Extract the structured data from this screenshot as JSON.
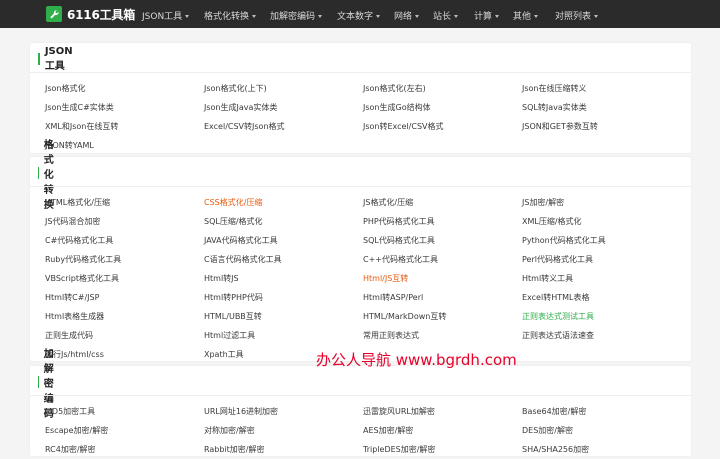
{
  "header": {
    "logo_text": "6116工具箱",
    "nav": [
      {
        "label": "JSON工具"
      },
      {
        "label": "格式化转换"
      },
      {
        "label": "加解密编码"
      },
      {
        "label": "文本数字"
      },
      {
        "label": "网络"
      },
      {
        "label": "站长"
      },
      {
        "label": "计算"
      },
      {
        "label": "其他"
      },
      {
        "label": "对照列表"
      }
    ]
  },
  "sections": [
    {
      "title": "JSON工具",
      "items": [
        {
          "label": "Json格式化"
        },
        {
          "label": "Json格式化(上下)"
        },
        {
          "label": "Json格式化(左右)"
        },
        {
          "label": "Json在线压缩转义"
        },
        {
          "label": "Json生成C#实体类"
        },
        {
          "label": "Json生成Java实体类"
        },
        {
          "label": "Json生成Go结构体"
        },
        {
          "label": "SQL转Java实体类"
        },
        {
          "label": "XML和Json在线互转"
        },
        {
          "label": "Excel/CSV转Json格式"
        },
        {
          "label": "Json转Excel/CSV格式"
        },
        {
          "label": "JSON和GET参数互转"
        },
        {
          "label": "JSON转YAML"
        }
      ]
    },
    {
      "title": "格式化转换",
      "items": [
        {
          "label": "HTML格式化/压缩"
        },
        {
          "label": "CSS格式化/压缩",
          "color": "#e8590c"
        },
        {
          "label": "JS格式化/压缩"
        },
        {
          "label": "JS加密/解密"
        },
        {
          "label": "JS代码混合加密"
        },
        {
          "label": "SQL压缩/格式化"
        },
        {
          "label": "PHP代码格式化工具"
        },
        {
          "label": "XML压缩/格式化"
        },
        {
          "label": "C#代码格式化工具"
        },
        {
          "label": "JAVA代码格式化工具"
        },
        {
          "label": "SQL代码格式化工具"
        },
        {
          "label": "Python代码格式化工具"
        },
        {
          "label": "Ruby代码格式化工具"
        },
        {
          "label": "C语言代码格式化工具"
        },
        {
          "label": "C++代码格式化工具"
        },
        {
          "label": "Perl代码格式化工具"
        },
        {
          "label": "VBScript格式化工具"
        },
        {
          "label": "Html转JS"
        },
        {
          "label": "Html/JS互转",
          "color": "#e8590c"
        },
        {
          "label": "Html转义工具"
        },
        {
          "label": "Html转C#/JSP"
        },
        {
          "label": "Html转PHP代码"
        },
        {
          "label": "Html转ASP/Perl"
        },
        {
          "label": "Excel转HTML表格"
        },
        {
          "label": "Html表格生成器"
        },
        {
          "label": "HTML/UBB互转"
        },
        {
          "label": "HTML/MarkDown互转"
        },
        {
          "label": "正则表达式测试工具",
          "color": "#2fae49"
        },
        {
          "label": "正则生成代码"
        },
        {
          "label": "Html过滤工具"
        },
        {
          "label": "常用正则表达式"
        },
        {
          "label": "正则表达式语法速查"
        },
        {
          "label": "运行Js/html/css"
        },
        {
          "label": "Xpath工具"
        }
      ]
    },
    {
      "title": "加解密编码",
      "items": [
        {
          "label": "MD5加密工具"
        },
        {
          "label": "URL网址16进制加密"
        },
        {
          "label": "迅雷旋风URL加解密"
        },
        {
          "label": "Base64加密/解密"
        },
        {
          "label": "Escape加密/解密"
        },
        {
          "label": "对称加密/解密"
        },
        {
          "label": "AES加密/解密"
        },
        {
          "label": "DES加密/解密"
        },
        {
          "label": "RC4加密/解密"
        },
        {
          "label": "Rabbit加密/解密"
        },
        {
          "label": "TripleDES加密/解密"
        },
        {
          "label": "SHA/SHA256加密"
        }
      ]
    }
  ],
  "watermark": "办公人导航 www.bgrdh.com",
  "colors": {
    "accent": "#2fae49",
    "highlight_orange": "#e8590c",
    "topbar": "#2b2b2b",
    "watermark": "#e8002a"
  }
}
